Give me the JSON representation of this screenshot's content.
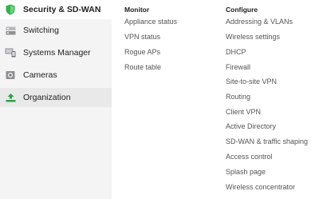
{
  "sidebar": {
    "items": [
      {
        "label": "Security & SD-WAN",
        "icon": "shield-icon"
      },
      {
        "label": "Switching",
        "icon": "switch-icon"
      },
      {
        "label": "Systems Manager",
        "icon": "devices-icon"
      },
      {
        "label": "Cameras",
        "icon": "camera-icon"
      },
      {
        "label": "Organization",
        "icon": "organization-icon"
      }
    ]
  },
  "menu": {
    "monitor": {
      "heading": "Monitor",
      "items": [
        "Appliance status",
        "VPN status",
        "Rogue APs",
        "Route table"
      ]
    },
    "configure": {
      "heading": "Configure",
      "items": [
        "Addressing & VLANs",
        "Wireless settings",
        "DHCP",
        "Firewall",
        "Site-to-site VPN",
        "Routing",
        "Client VPN",
        "Active Directory",
        "SD-WAN & traffic shaping",
        "Access control",
        "Splash page",
        "Wireless concentrator"
      ]
    }
  },
  "colors": {
    "shield_green": "#2fb44a",
    "organization_green": "#2fa043",
    "sidebar_bg": "#f4f4f5"
  }
}
